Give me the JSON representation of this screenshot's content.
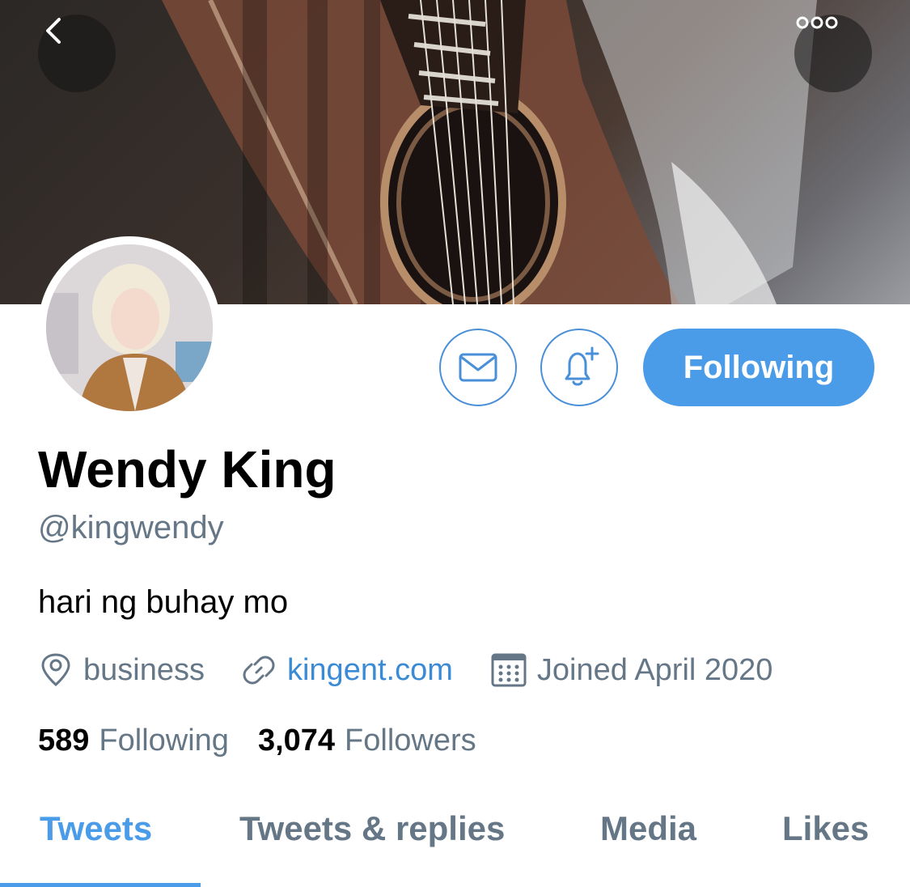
{
  "header": {
    "back_icon": "chevron-left-icon",
    "more_icon": "more-horizontal-icon"
  },
  "profile": {
    "name": "Wendy King",
    "handle": "@kingwendy",
    "bio": "hari ng buhay mo",
    "location": "business",
    "website": "kingent.com",
    "joined": "Joined April 2020"
  },
  "actions": {
    "message_icon": "envelope-icon",
    "notify_icon": "bell-plus-icon",
    "following_label": "Following"
  },
  "stats": {
    "following_count": "589",
    "following_label": "Following",
    "followers_count": "3,074",
    "followers_label": "Followers"
  },
  "tabs": [
    {
      "label": "Tweets",
      "active": true
    },
    {
      "label": "Tweets & replies",
      "active": false
    },
    {
      "label": "Media",
      "active": false
    },
    {
      "label": "Likes",
      "active": false
    }
  ],
  "colors": {
    "accent": "#4a9be8",
    "link": "#3a8ad6",
    "muted": "#657786"
  }
}
